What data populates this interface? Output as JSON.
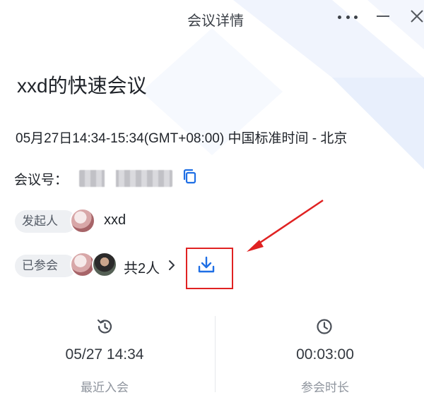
{
  "window": {
    "title": "会议详情"
  },
  "meeting": {
    "title": "xxd的快速会议",
    "time": "05月27日14:34-15:34(GMT+08:00) 中国标准时间 - 北京",
    "id_label": "会议号："
  },
  "organizer": {
    "tag": "发起人",
    "name": "xxd"
  },
  "participants": {
    "tag": "已参会",
    "count_label": "共2人"
  },
  "stats": {
    "recent_join": {
      "value": "05/27 14:34",
      "label": "最近入会"
    },
    "duration": {
      "value": "00:03:00",
      "label": "参会时长"
    }
  },
  "colors": {
    "accent": "#1f6fe5",
    "annotation": "#e02222",
    "text": "#1f2329",
    "muted": "#8f959e"
  },
  "icons": {
    "more": "more-horizontal-icon",
    "minimize": "minimize-icon",
    "close": "close-icon",
    "copy": "copy-icon",
    "download": "download-icon",
    "history": "history-clock-icon",
    "clock": "clock-icon",
    "chevron": "chevron-right-icon"
  }
}
